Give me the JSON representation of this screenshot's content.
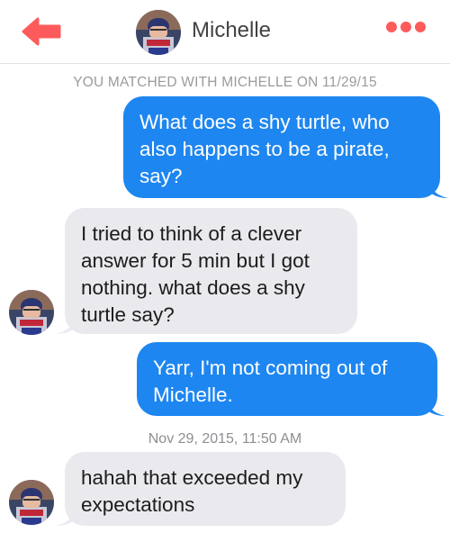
{
  "header": {
    "back_icon": "back-arrow-icon",
    "contact_name": "Michelle",
    "more_icon": "more-dots-icon",
    "accent_color": "#fd5b5b"
  },
  "match_note": "YOU MATCHED WITH MICHELLE ON 11/29/15",
  "messages": [
    {
      "direction": "outgoing",
      "text": "What does a shy turtle, who also happens to be a pirate, say?"
    },
    {
      "direction": "incoming",
      "text": "I tried to think of a clever answer for 5 min but I got nothing. what does a shy turtle say?"
    },
    {
      "direction": "outgoing",
      "text": "Yarr, I'm not coming out of Michelle."
    },
    {
      "direction": "incoming",
      "text": "hahah that exceeded my expectations"
    }
  ],
  "timestamp": "Nov 29, 2015, 11:50 AM",
  "colors": {
    "outgoing_bubble": "#1e86f0",
    "incoming_bubble": "#e9e9ee"
  }
}
